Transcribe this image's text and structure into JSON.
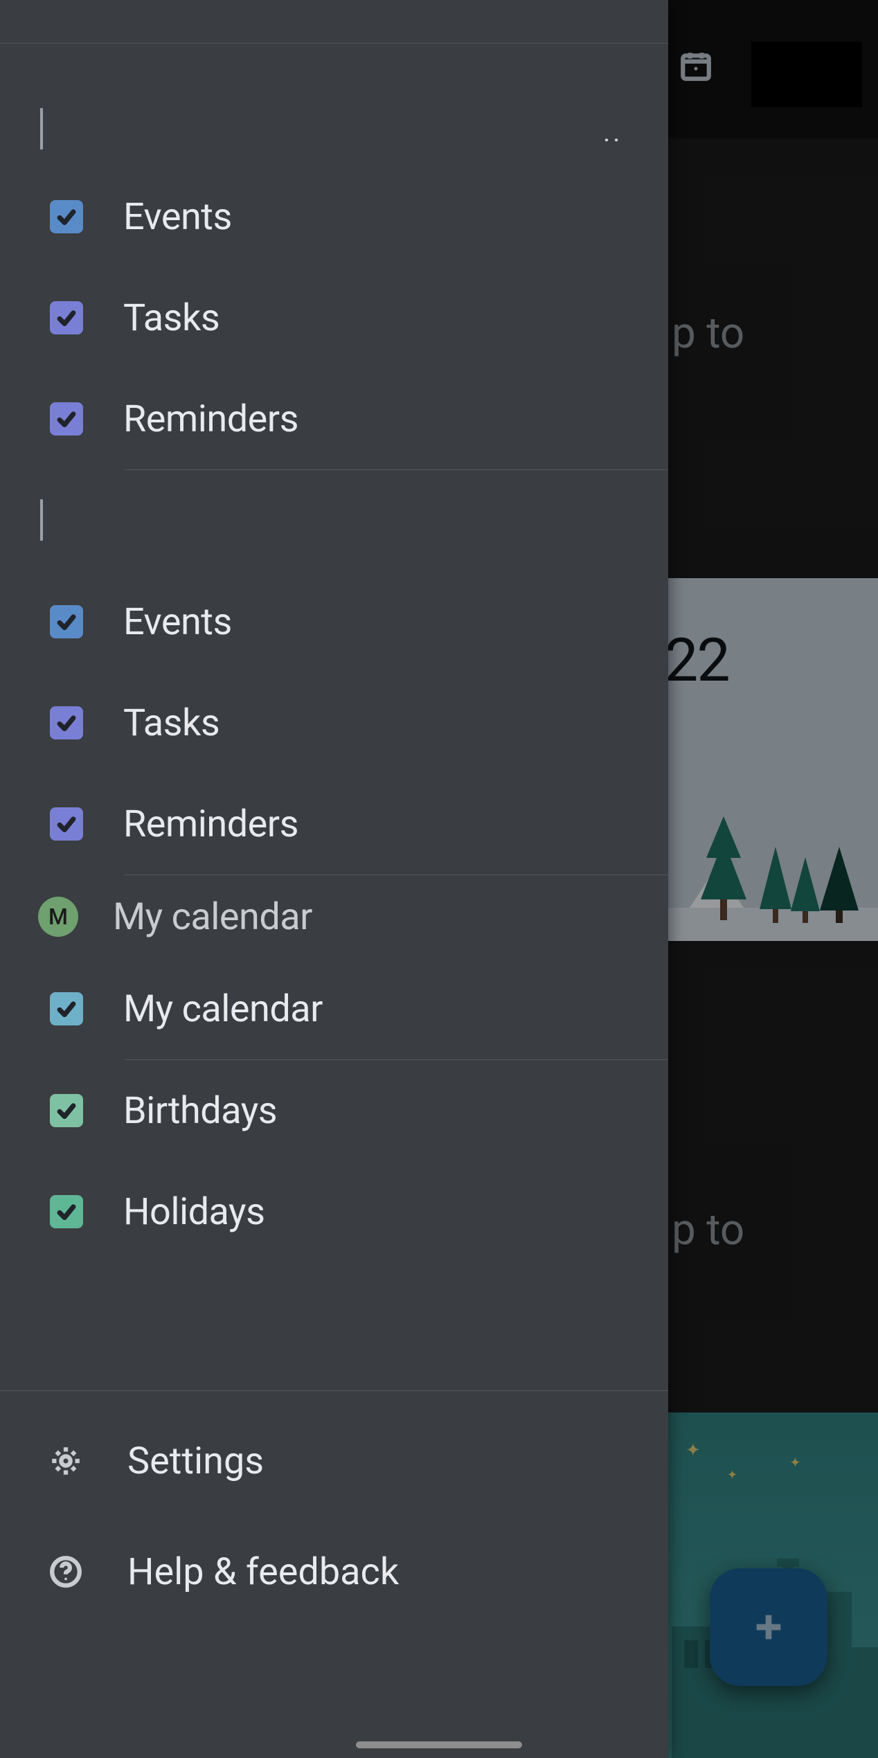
{
  "background": {
    "topbar": {
      "today_icon": "today-icon"
    },
    "peek_text_1": "p to",
    "peek_text_2": "p to",
    "banner_year": "22",
    "fab_icon": "plus-icon"
  },
  "drawer": {
    "accounts": [
      {
        "id": "acct1",
        "avatar_hint": "",
        "items": [
          {
            "label": "Events",
            "color": "#5a8bc9",
            "checked": true
          },
          {
            "label": "Tasks",
            "color": "#7a7fd6",
            "checked": true
          },
          {
            "label": "Reminders",
            "color": "#7a7fd6",
            "checked": true
          }
        ]
      },
      {
        "id": "acct2",
        "avatar_hint": "",
        "items": [
          {
            "label": "Events",
            "color": "#5a8bc9",
            "checked": true
          },
          {
            "label": "Tasks",
            "color": "#7a7fd6",
            "checked": true
          },
          {
            "label": "Reminders",
            "color": "#7a7fd6",
            "checked": true
          }
        ]
      }
    ],
    "my_calendar_header": {
      "avatar_letter": "M",
      "avatar_color": "#6fa06f",
      "label": "My calendar"
    },
    "my_calendar_item": {
      "label": "My calendar",
      "color": "#6fb0c9",
      "checked": true
    },
    "extra": [
      {
        "label": "Birthdays",
        "color": "#7fc2a3",
        "checked": true
      },
      {
        "label": "Holidays",
        "color": "#5fb796",
        "checked": true
      }
    ],
    "footer": {
      "settings": "Settings",
      "help": "Help & feedback"
    }
  }
}
